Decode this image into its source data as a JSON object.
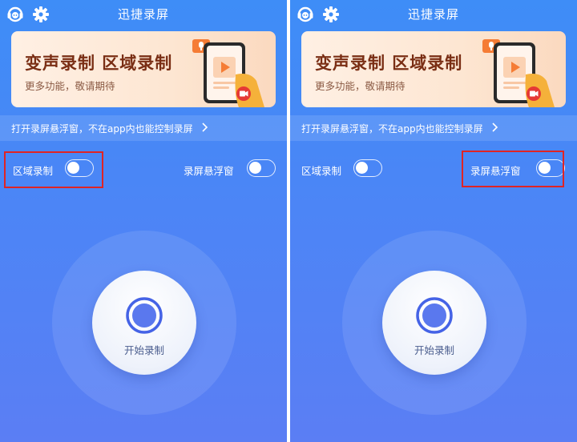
{
  "panels": [
    {
      "header": {
        "title": "迅捷录屏"
      },
      "banner": {
        "title": "变声录制 区域录制",
        "subtitle": "更多功能，敬请期待"
      },
      "tip": {
        "text": "打开录屏悬浮窗，不在app内也能控制录屏"
      },
      "toggles": [
        {
          "label": "区域录制",
          "on": false
        },
        {
          "label": "录屏悬浮窗",
          "on": false
        }
      ],
      "record": {
        "label": "开始录制"
      },
      "highlighted_toggle": "区域录制"
    },
    {
      "header": {
        "title": "迅捷录屏"
      },
      "banner": {
        "title": "变声录制 区域录制",
        "subtitle": "更多功能，敬请期待"
      },
      "tip": {
        "text": "打开录屏悬浮窗，不在app内也能控制录屏"
      },
      "toggles": [
        {
          "label": "区域录制",
          "on": false
        },
        {
          "label": "录屏悬浮窗",
          "on": false
        }
      ],
      "record": {
        "label": "开始录制"
      },
      "highlighted_toggle": "录屏悬浮窗"
    }
  ],
  "icons": {
    "service": "customer-service-icon",
    "settings": "gear-icon",
    "tip_arrow": "chevron-right-icon",
    "record": "record-icon"
  },
  "colors": {
    "background": "#4a86f6",
    "highlight": "#e02424",
    "banner_title": "#7a2e14"
  }
}
